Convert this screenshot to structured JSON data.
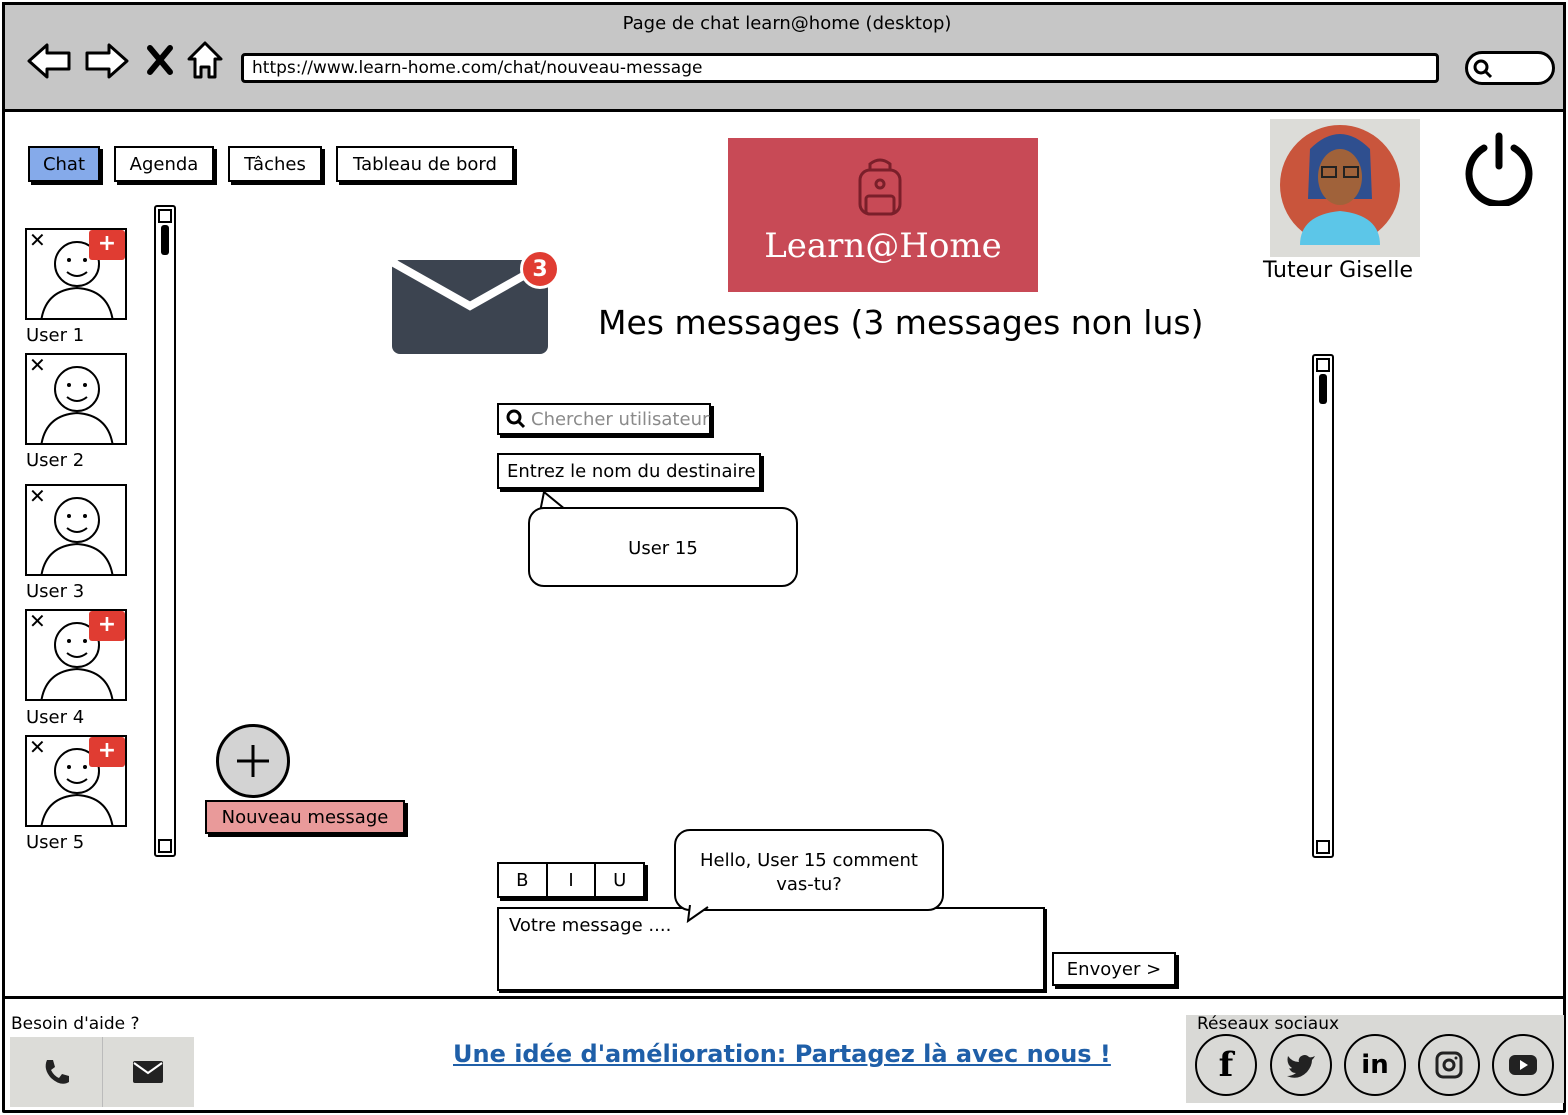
{
  "window": {
    "title": "Page de chat learn@home (desktop)"
  },
  "browser": {
    "url": "https://www.learn-home.com/chat/nouveau-message"
  },
  "tabs": [
    {
      "label": "Chat",
      "active": true
    },
    {
      "label": "Agenda",
      "active": false
    },
    {
      "label": "Tâches",
      "active": false
    },
    {
      "label": "Tableau de bord",
      "active": false
    }
  ],
  "logo": {
    "text": "Learn@Home",
    "bg_color": "#c84a56"
  },
  "profile": {
    "name": "Tuteur Giselle"
  },
  "messages_badge": {
    "count": "3"
  },
  "heading": "Mes messages (3 messages non lus)",
  "users": [
    {
      "label": "User 1",
      "has_new": true
    },
    {
      "label": "User 2",
      "has_new": false
    },
    {
      "label": "User 3",
      "has_new": false
    },
    {
      "label": "User 4",
      "has_new": true
    },
    {
      "label": "User 5",
      "has_new": true
    }
  ],
  "new_message": {
    "label": "Nouveau message"
  },
  "search": {
    "placeholder": "Chercher utilisateur"
  },
  "recipient": {
    "label": "Entrez le nom du destinaire",
    "suggestion": "User 15"
  },
  "editor": {
    "bold": "B",
    "italic": "I",
    "underline": "U",
    "placeholder": "Votre message ....",
    "send_label": "Envoyer >",
    "draft_bubble": "Hello, User 15 comment vas-tu?"
  },
  "footer": {
    "help_label": "Besoin d'aide ?",
    "feedback_link": "Une idée d'amélioration: Partagez là avec nous !",
    "social_label": "Réseaux sociaux",
    "social_icons": [
      "f",
      "t",
      "in",
      "ig",
      "yt"
    ]
  },
  "colors": {
    "active_tab": "#85aaea",
    "new_message_btn": "#e99a9a",
    "badge_red": "#e03c32",
    "envelope": "#3c4450",
    "link": "#1f5fa8"
  }
}
